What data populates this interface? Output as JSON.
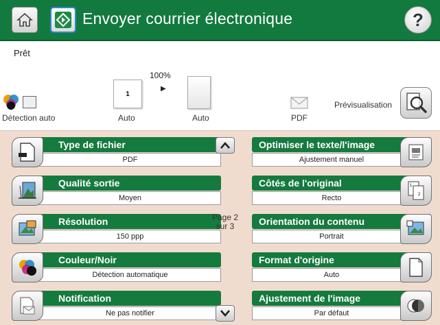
{
  "header": {
    "title": "Envoyer courrier électronique",
    "help_glyph": "?",
    "accent": "#127a3e"
  },
  "status": {
    "text": "Prêt"
  },
  "preview": {
    "zoom": "100%",
    "page_number": "1",
    "color_label": "Détection auto",
    "size_label_1": "Auto",
    "size_label_2": "Auto",
    "format_label": "PDF",
    "preview_label": "Prévisualisation"
  },
  "settings": {
    "left": [
      {
        "label": "Type de fichier",
        "value": "PDF",
        "icon": "file-type-icon"
      },
      {
        "label": "Qualité sortie",
        "value": "Moyen",
        "icon": "output-quality-icon"
      },
      {
        "label": "Résolution",
        "value": "150 ppp",
        "icon": "resolution-icon"
      },
      {
        "label": "Couleur/Noir",
        "value": "Détection automatique",
        "icon": "color-black-icon"
      },
      {
        "label": "Notification",
        "value": "Ne pas notifier",
        "icon": "notification-icon"
      }
    ],
    "right": [
      {
        "label": "Optimiser le texte/l'image",
        "value": "Ajustement manuel",
        "icon": "optimize-icon"
      },
      {
        "label": "Côtés de l'original",
        "value": "Recto",
        "icon": "original-sides-icon"
      },
      {
        "label": "Orientation du contenu",
        "value": "Portrait",
        "icon": "orientation-icon"
      },
      {
        "label": "Format d'origine",
        "value": "Auto",
        "icon": "original-size-icon"
      },
      {
        "label": "Ajustement de l'image",
        "value": "Par défaut",
        "icon": "image-adjust-icon"
      }
    ]
  },
  "pager": {
    "line1": "Page 2",
    "line2": "sur 3"
  }
}
